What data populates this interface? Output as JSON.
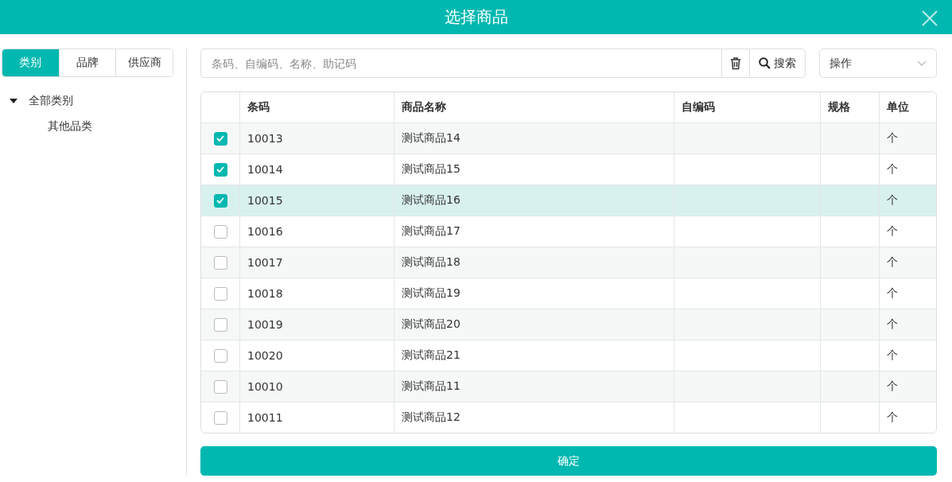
{
  "window": {
    "title": "选择商品"
  },
  "filter_tabs": [
    {
      "label": "类别",
      "selected": true
    },
    {
      "label": "品牌",
      "selected": false
    },
    {
      "label": "供应商",
      "selected": false
    }
  ],
  "category_tree": [
    {
      "label": "全部类别",
      "expanded": true,
      "children": [
        {
          "label": "其他品类"
        }
      ]
    }
  ],
  "search": {
    "placeholder": "条码、自编码、名称、助记码",
    "button": "搜索"
  },
  "action_select": {
    "value": "操作"
  },
  "table": {
    "columns": [
      "条码",
      "商品名称",
      "自编码",
      "规格",
      "单位"
    ],
    "rows": [
      {
        "checked": true,
        "highlighted": false,
        "cells": [
          "10013",
          "测试商品14",
          "",
          "",
          "个"
        ]
      },
      {
        "checked": true,
        "highlighted": false,
        "cells": [
          "10014",
          "测试商品15",
          "",
          "",
          "个"
        ]
      },
      {
        "checked": true,
        "highlighted": true,
        "cells": [
          "10015",
          "测试商品16",
          "",
          "",
          "个"
        ]
      },
      {
        "checked": false,
        "highlighted": false,
        "cells": [
          "10016",
          "测试商品17",
          "",
          "",
          "个"
        ]
      },
      {
        "checked": false,
        "highlighted": false,
        "cells": [
          "10017",
          "测试商品18",
          "",
          "",
          "个"
        ]
      },
      {
        "checked": false,
        "highlighted": false,
        "cells": [
          "10018",
          "测试商品19",
          "",
          "",
          "个"
        ]
      },
      {
        "checked": false,
        "highlighted": false,
        "cells": [
          "10019",
          "测试商品20",
          "",
          "",
          "个"
        ]
      },
      {
        "checked": false,
        "highlighted": false,
        "cells": [
          "10020",
          "测试商品21",
          "",
          "",
          "个"
        ]
      },
      {
        "checked": false,
        "highlighted": false,
        "cells": [
          "10010",
          "测试商品11",
          "",
          "",
          "个"
        ]
      },
      {
        "checked": false,
        "highlighted": false,
        "cells": [
          "10011",
          "测试商品12",
          "",
          "",
          "个"
        ]
      }
    ]
  },
  "confirm_button": "确定"
}
